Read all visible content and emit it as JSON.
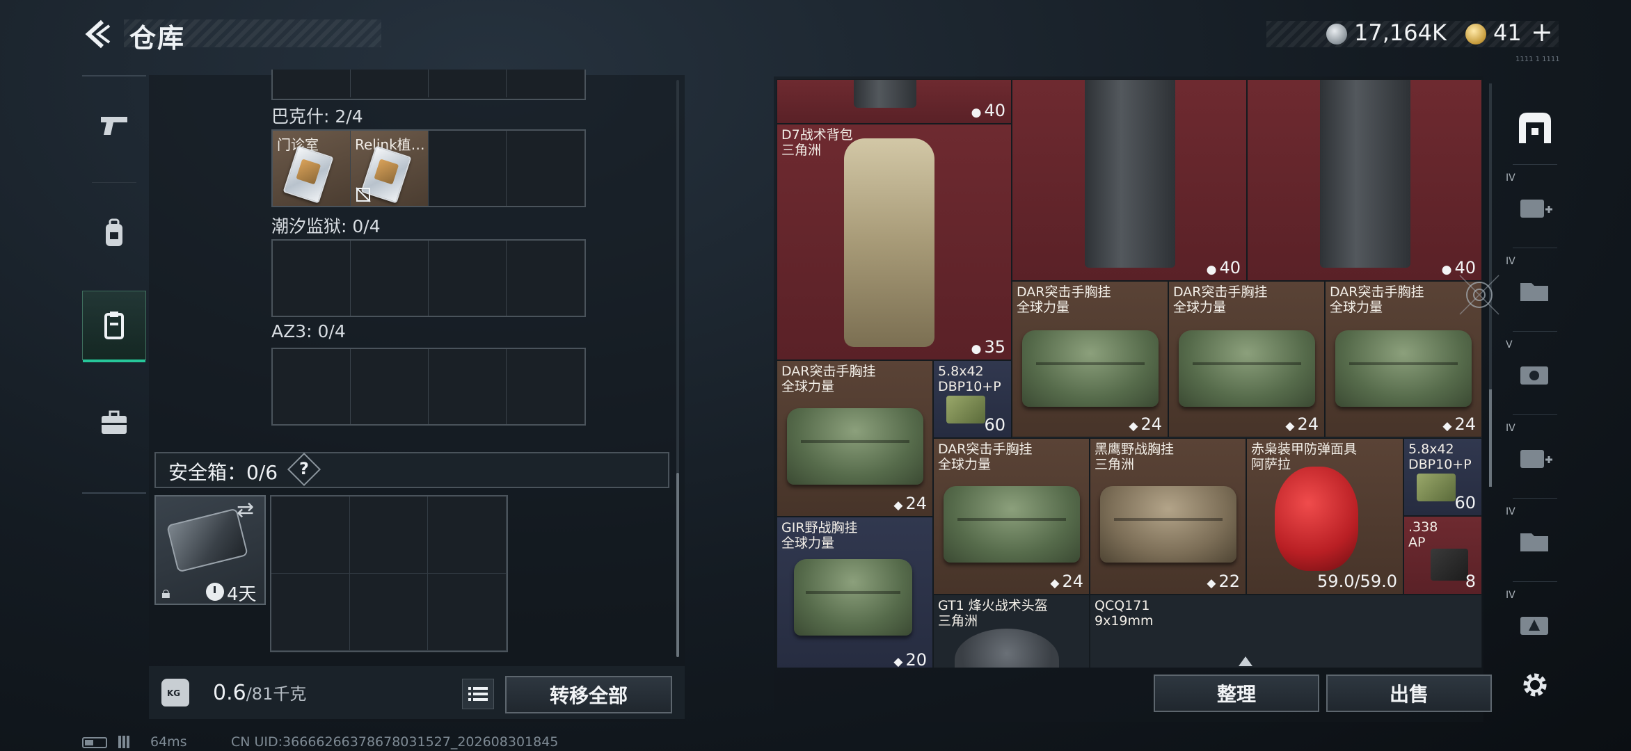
{
  "header": {
    "title": "仓库",
    "currency_silver": "17,164K",
    "currency_gold": "41",
    "plus_label": "+",
    "tiny_tag": "1111 1 1111"
  },
  "left_nav": {
    "items": [
      {
        "name": "weapons",
        "icon": "pistol-icon"
      },
      {
        "name": "equipment",
        "icon": "backpack-icon"
      },
      {
        "name": "consumables",
        "icon": "case-icon",
        "active": true
      },
      {
        "name": "keys",
        "icon": "briefcase-icon"
      }
    ]
  },
  "key_groups": [
    {
      "label": "巴克什: 2/4",
      "items": [
        "门诊室",
        "Relink植…"
      ]
    },
    {
      "label": "潮汐监狱: 0/4",
      "items": []
    },
    {
      "label": "AZ3: 0/4",
      "items": []
    }
  ],
  "safe_box": {
    "label": "安全箱：0/6",
    "help": "?",
    "duration": "4天"
  },
  "bottom_left": {
    "weight_current": "0.6",
    "weight_max": "/81千克",
    "kg_label": "KG",
    "transfer_all_label": "转移全部"
  },
  "bottom_right": {
    "sort_label": "整理",
    "sell_label": "出售"
  },
  "inventory": [
    {
      "name": "",
      "sub": "",
      "count": "40"
    },
    {
      "name": "",
      "sub": "",
      "count": "40"
    },
    {
      "name": "",
      "sub": "",
      "count": "40"
    },
    {
      "name": "D7战术背包",
      "sub": "三角洲",
      "count": "35"
    },
    {
      "name": "DAR突击手胸挂",
      "sub": "全球力量",
      "count": "24"
    },
    {
      "name": "DAR突击手胸挂",
      "sub": "全球力量",
      "count": "24"
    },
    {
      "name": "DAR突击手胸挂",
      "sub": "全球力量",
      "count": "24"
    },
    {
      "name": "DAR突击手胸挂",
      "sub": "全球力量",
      "count": "24"
    },
    {
      "name": "5.8x42",
      "sub": "DBP10+P",
      "count": "60"
    },
    {
      "name": "DAR突击手胸挂",
      "sub": "全球力量",
      "count": "24"
    },
    {
      "name": "黑鹰野战胸挂",
      "sub": "三角洲",
      "count": "22"
    },
    {
      "name": "赤枭装甲防弹面具",
      "sub": "阿萨拉",
      "count": "59.0/59.0"
    },
    {
      "name": "5.8x42",
      "sub": "DBP10+P",
      "count": "60"
    },
    {
      "name": ".338",
      "sub": "AP",
      "count": "8"
    },
    {
      "name": "GIR野战胸挂",
      "sub": "全球力量",
      "count": "20"
    },
    {
      "name": "GT1 烽火战术头盔",
      "sub": "三角洲",
      "count": ""
    },
    {
      "name": "QCQ171",
      "sub": "9x19mm",
      "count": ""
    }
  ],
  "right_tools": [
    {
      "name": "storage-home",
      "tier": ""
    },
    {
      "name": "expand-a",
      "tier": "IV"
    },
    {
      "name": "expand-b",
      "tier": "IV"
    },
    {
      "name": "expand-c",
      "tier": "V"
    },
    {
      "name": "expand-d",
      "tier": "IV"
    },
    {
      "name": "expand-e",
      "tier": "IV"
    },
    {
      "name": "expand-f",
      "tier": "IV"
    }
  ],
  "status": {
    "ping": "64ms",
    "uid": "CN UID:36666266378678031527_202608301845"
  },
  "colors": {
    "accent_green": "#27c79a",
    "rare_red": "#6e2a30",
    "common_brown": "#5a4336",
    "uncommon_navy": "#31384f"
  }
}
